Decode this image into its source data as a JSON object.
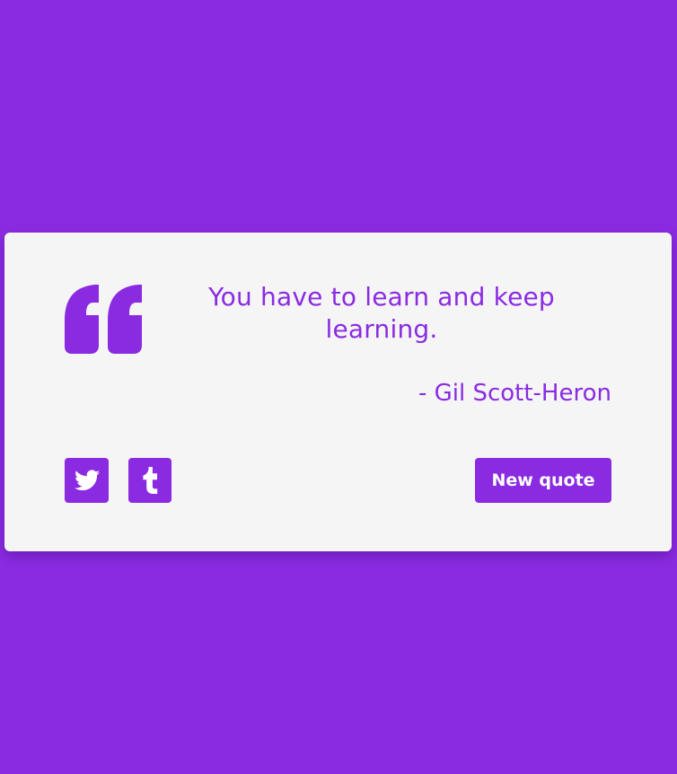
{
  "quote": {
    "text": "You have to learn and keep learning.",
    "author": "- Gil Scott-Heron"
  },
  "share": {
    "twitter_icon": "twitter-icon",
    "tumblr_icon": "tumblr-icon"
  },
  "actions": {
    "new_quote_label": "New quote"
  },
  "colors": {
    "background": "#8a2be2",
    "card": "#f5f5f5",
    "accent": "#8a2be2"
  }
}
